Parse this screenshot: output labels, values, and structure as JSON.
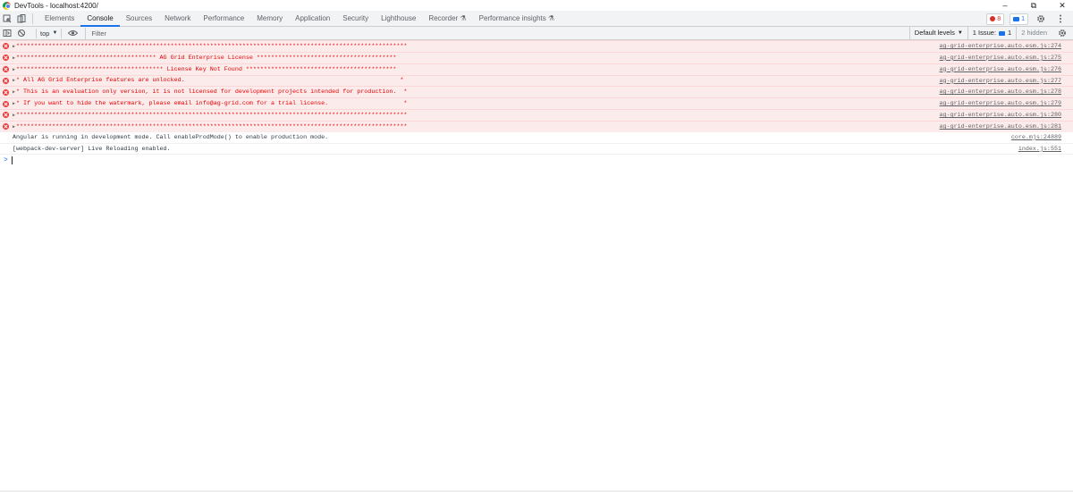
{
  "window": {
    "title": "DevTools - localhost:4200/",
    "minimize": "–",
    "restore": "⧉",
    "close": "✕"
  },
  "tabs": [
    {
      "label": "Elements"
    },
    {
      "label": "Console"
    },
    {
      "label": "Sources"
    },
    {
      "label": "Network"
    },
    {
      "label": "Performance"
    },
    {
      "label": "Memory"
    },
    {
      "label": "Application"
    },
    {
      "label": "Security"
    },
    {
      "label": "Lighthouse"
    },
    {
      "label": "Recorder ⚗"
    },
    {
      "label": "Performance insights ⚗"
    }
  ],
  "active_tab": "Console",
  "status": {
    "errors": "8",
    "messages": "1"
  },
  "toolbar": {
    "context": "top",
    "filter_placeholder": "Filter",
    "levels": "Default levels",
    "issues": "1 Issue:",
    "issues_count": "1",
    "hidden": "2 hidden"
  },
  "console": {
    "errors": [
      {
        "msg": "*************************************************************************************************************",
        "src": "ag-grid-enterprise.auto.esm.js:274"
      },
      {
        "msg": "*************************************** AG Grid Enterprise License ***************************************",
        "src": "ag-grid-enterprise.auto.esm.js:275"
      },
      {
        "msg": "***************************************** License Key Not Found ******************************************",
        "src": "ag-grid-enterprise.auto.esm.js:276"
      },
      {
        "msg": "* All AG Grid Enterprise features are unlocked.                                                            *",
        "src": "ag-grid-enterprise.auto.esm.js:277"
      },
      {
        "msg": "* This is an evaluation only version, it is not licensed for development projects intended for production.  *",
        "src": "ag-grid-enterprise.auto.esm.js:278"
      },
      {
        "msg": "* If you want to hide the watermark, please email info@ag-grid.com for a trial license.                     *",
        "src": "ag-grid-enterprise.auto.esm.js:279"
      },
      {
        "msg": "*************************************************************************************************************",
        "src": "ag-grid-enterprise.auto.esm.js:280"
      },
      {
        "msg": "*************************************************************************************************************",
        "src": "ag-grid-enterprise.auto.esm.js:281"
      }
    ],
    "info": [
      {
        "msg": "Angular is running in development mode. Call enableProdMode() to enable production mode.",
        "src": "core.mjs:24889"
      },
      {
        "msg": "[webpack-dev-server] Live Reloading enabled.",
        "src": "index.js:551"
      }
    ],
    "prompt": ">"
  }
}
